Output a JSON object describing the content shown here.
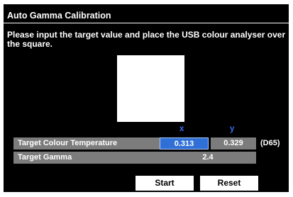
{
  "dialog": {
    "title": "Auto Gamma Calibration",
    "instruction": "Please input the target value and place the USB colour analyser over the square."
  },
  "columns": {
    "x_label": "x",
    "y_label": "y"
  },
  "target_colour_temperature": {
    "label": "Target Colour Temperature",
    "x_value": "0.313",
    "y_value": "0.329",
    "suffix": "(D65)"
  },
  "target_gamma": {
    "label": "Target Gamma",
    "value": "2.4"
  },
  "buttons": {
    "start": "Start",
    "reset": "Reset"
  },
  "colors": {
    "background": "#000000",
    "field_gray": "#7c7c7c",
    "selected_blue": "#2f6fd6",
    "column_header_blue": "#3a6ff0"
  }
}
